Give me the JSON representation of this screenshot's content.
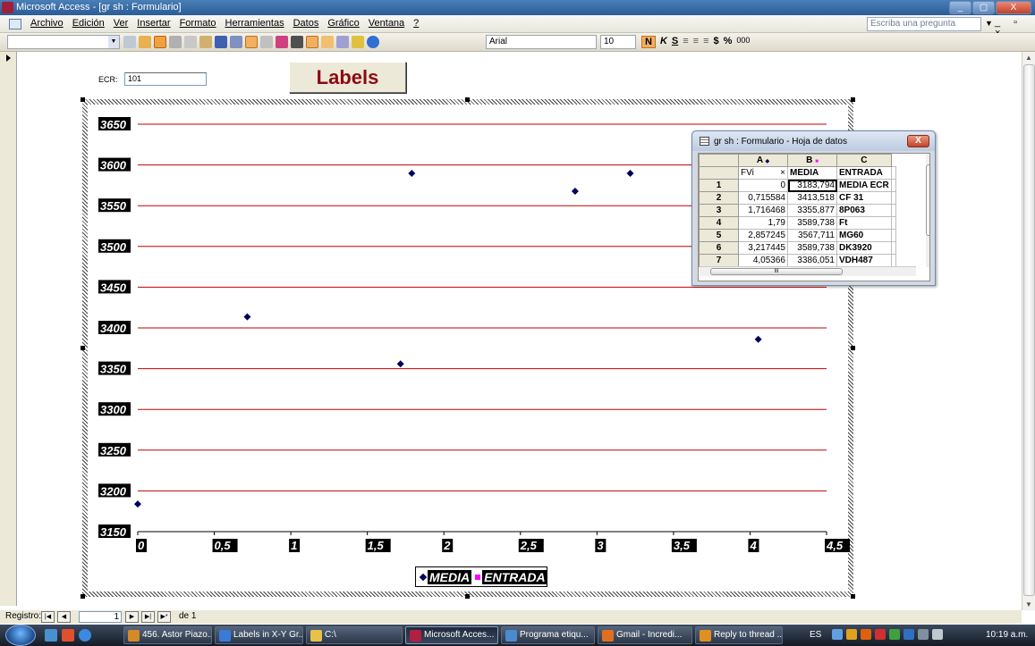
{
  "window": {
    "title": "Microsoft Access - [gr sh : Formulario]",
    "controls": [
      "_",
      "▢",
      "X"
    ]
  },
  "menubar": {
    "items": [
      "Archivo",
      "Edición",
      "Ver",
      "Insertar",
      "Formato",
      "Herramientas",
      "Datos",
      "Gráfico",
      "Ventana",
      "?"
    ],
    "ask_placeholder": "Escriba una pregunta",
    "mdi_controls": "_ ▫ ×"
  },
  "toolbar": {
    "object_combo_value": "",
    "font": "Arial",
    "font_size": "10",
    "format_buttons": [
      "N",
      "K",
      "S"
    ],
    "currency": "$",
    "percent": "%",
    "thousands": "000"
  },
  "form": {
    "ecr_label": "ECR:",
    "ecr_value": "101",
    "labels_button": "Labels"
  },
  "chart_data": {
    "type": "scatter",
    "title": "",
    "xlabel": "",
    "ylabel": "",
    "xlim": [
      0,
      4.5
    ],
    "ylim": [
      3150,
      3650
    ],
    "xticks": [
      "0",
      "0,5",
      "1",
      "1,5",
      "2",
      "2,5",
      "3",
      "3,5",
      "4",
      "4,5"
    ],
    "yticks": [
      "3650",
      "3600",
      "3550",
      "3500",
      "3450",
      "3400",
      "3350",
      "3300",
      "3250",
      "3200",
      "3150"
    ],
    "grid": true,
    "grid_color": "#c00000",
    "legend_placement": "bottom",
    "series": [
      {
        "name": "MEDIA",
        "marker": "diamond",
        "color": "#000060",
        "x": [
          0,
          0.715584,
          1.716468,
          1.79,
          2.857245,
          3.217445,
          4.05366
        ],
        "y": [
          3183.794,
          3413.518,
          3355.877,
          3589.738,
          3567.711,
          3589.738,
          3386.051
        ]
      },
      {
        "name": "ENTRADA",
        "marker": "square",
        "color": "#ff00ff",
        "x": [],
        "y": []
      }
    ]
  },
  "datasheet": {
    "title": "gr sh : Formulario - Hoja de datos",
    "close": "X",
    "col_letters": [
      "",
      "A",
      "B",
      "C"
    ],
    "header_row": [
      "FVi",
      "MEDIA",
      "ENTRADA",
      ""
    ],
    "first_cell_icon": "×",
    "rows": [
      {
        "n": "1",
        "fvi": "0",
        "media": "3183,794",
        "entrada": "MEDIA ECR"
      },
      {
        "n": "2",
        "fvi": "0,715584",
        "media": "3413,518",
        "entrada": "CF 31"
      },
      {
        "n": "3",
        "fvi": "1,716468",
        "media": "3355,877",
        "entrada": "8P063"
      },
      {
        "n": "4",
        "fvi": "1,79",
        "media": "3589,738",
        "entrada": "Ft"
      },
      {
        "n": "5",
        "fvi": "2,857245",
        "media": "3567,711",
        "entrada": "MG60"
      },
      {
        "n": "6",
        "fvi": "3,217445",
        "media": "3589,738",
        "entrada": "DK3920"
      },
      {
        "n": "7",
        "fvi": "4,05366",
        "media": "3386,051",
        "entrada": "VDH487"
      }
    ],
    "hscroll_grip": "III"
  },
  "record_nav": {
    "label": "Registro:",
    "current": "1",
    "of_label": "de 1"
  },
  "taskbar": {
    "buttons": [
      {
        "label": "456. Astor Piazo...",
        "color": "#d28a2a"
      },
      {
        "label": "Labels in X-Y Gr...",
        "color": "#3a7ad8"
      },
      {
        "label": "C:\\",
        "color": "#e6c24a"
      },
      {
        "label": "Microsoft Acces...",
        "color": "#b02040",
        "active": true
      },
      {
        "label": "Programa etiqu...",
        "color": "#4a8ad0"
      },
      {
        "label": "Gmail - Incredi...",
        "color": "#e07020"
      },
      {
        "label": "Reply to thread ...",
        "color": "#e09020"
      }
    ],
    "language": "ES",
    "clock": "10:19 a.m."
  }
}
